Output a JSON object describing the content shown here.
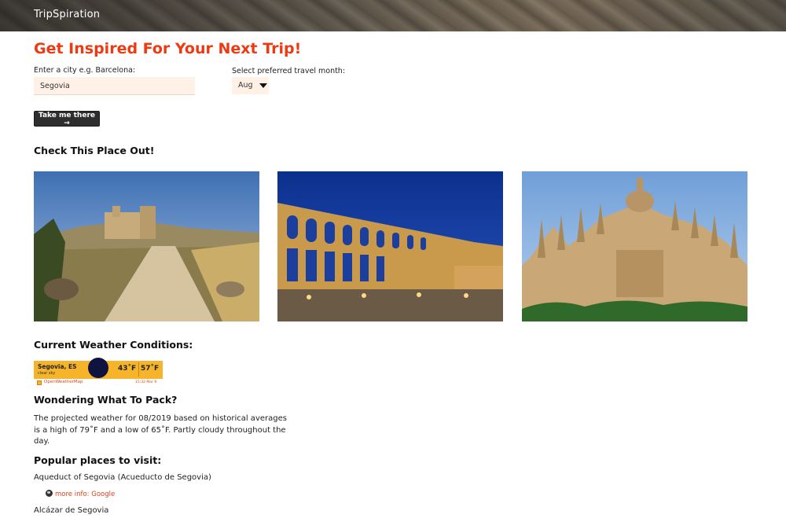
{
  "app": {
    "brand": "TripSpiration"
  },
  "hero": {
    "title": "Get Inspired For Your Next Trip!"
  },
  "form": {
    "city_label": "Enter a city e.g. Barcelona:",
    "city_value": "Segovia",
    "month_label": "Select preferred travel month:",
    "month_value": "Aug",
    "submit_label": "Take me there →"
  },
  "gallery": {
    "heading": "Check This Place Out!",
    "photos": [
      {
        "subject": "dirt path toward hilltop old town"
      },
      {
        "subject": "Aqueduct of Segovia at night"
      },
      {
        "subject": "Segovia Cathedral"
      }
    ]
  },
  "weather": {
    "heading": "Current Weather Conditions:",
    "city": "Segovia, ES",
    "description": "clear sky",
    "temp_low": "43˚F",
    "temp_high": "57˚F",
    "provider": "OpenWeatherMap",
    "timestamp": "15:32 Mar 9",
    "colors": {
      "bar": "#f6b42a",
      "moon": "#0f1340"
    }
  },
  "packing": {
    "heading": "Wondering What To Pack?",
    "text": "The projected weather for 08/2019 based on historical averages is a high of 79˚F and a low of 65˚F. Partly cloudy throughout the day."
  },
  "places": {
    "heading": "Popular places to visit:",
    "items": [
      {
        "name": "Aqueduct of Segovia (Acueducto de Segovia)",
        "link_label": "more info: Google"
      },
      {
        "name": "Alcázar de Segovia"
      }
    ]
  },
  "colors": {
    "accent": "#ec3b12",
    "link": "#e0421a",
    "input_bg": "#fff1e6",
    "button_bg": "#2e2e2e"
  }
}
